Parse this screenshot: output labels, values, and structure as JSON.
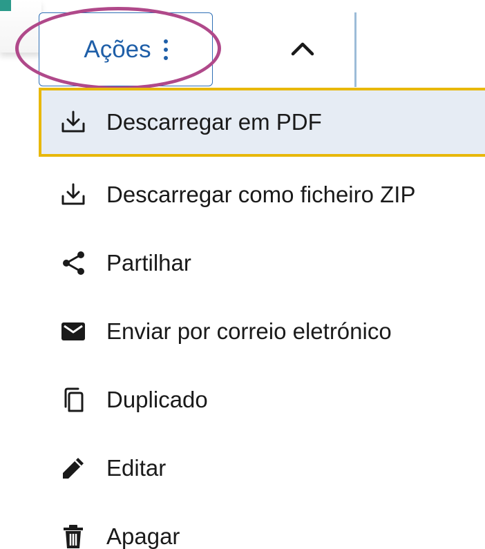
{
  "toolbar": {
    "actions_label": "Ações",
    "kebab_icon": "more-vertical-icon",
    "collapse_icon": "chevron-up-icon"
  },
  "menu": {
    "items": [
      {
        "label": "Descarregar em PDF",
        "icon": "download-icon",
        "active": true
      },
      {
        "label": "Descarregar como ficheiro ZIP",
        "icon": "download-icon",
        "active": false
      },
      {
        "label": "Partilhar",
        "icon": "share-icon",
        "active": false
      },
      {
        "label": "Enviar por correio eletrónico",
        "icon": "email-icon",
        "active": false
      },
      {
        "label": "Duplicado",
        "icon": "copy-icon",
        "active": false
      },
      {
        "label": "Editar",
        "icon": "pencil-icon",
        "active": false
      },
      {
        "label": "Apagar",
        "icon": "trash-icon",
        "active": false
      }
    ]
  },
  "colors": {
    "accent_blue": "#1f5fa8",
    "highlight_ellipse": "#b0498a",
    "focus_border": "#e8b80b",
    "active_bg": "#e6ecf4",
    "corner_marker": "#2b9a8a"
  }
}
